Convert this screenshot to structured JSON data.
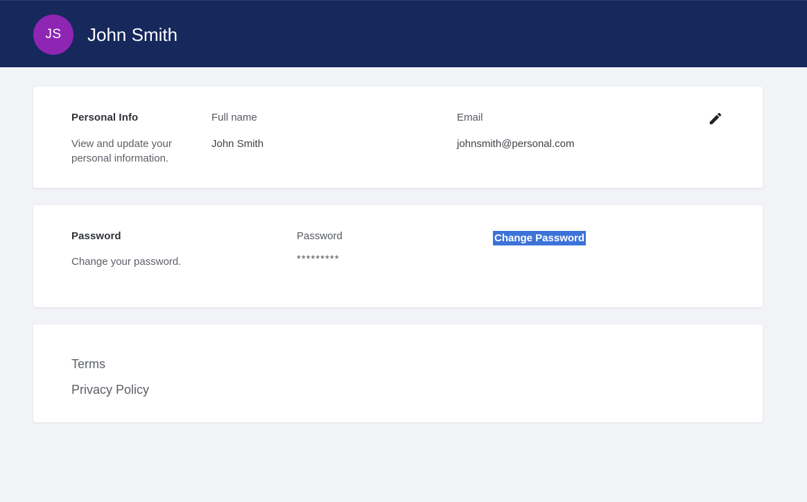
{
  "header": {
    "avatar_initials": "JS",
    "user_name": "John Smith"
  },
  "personal_info": {
    "title": "Personal Info",
    "description": "View and update your personal information.",
    "full_name_label": "Full name",
    "full_name_value": "John Smith",
    "email_label": "Email",
    "email_value": "johnsmith@personal.com",
    "edit_icon": "pencil-icon"
  },
  "password": {
    "title": "Password",
    "description": "Change your password.",
    "field_label": "Password",
    "field_value": "*********",
    "change_button_label": "Change Password"
  },
  "legal": {
    "terms_label": "Terms",
    "privacy_label": "Privacy Policy"
  },
  "colors": {
    "header_bg": "#16285c",
    "avatar_bg": "#8f25b3",
    "page_bg": "#f2f3f7",
    "card_bg": "#ffffff",
    "highlight": "#3d73d8"
  }
}
